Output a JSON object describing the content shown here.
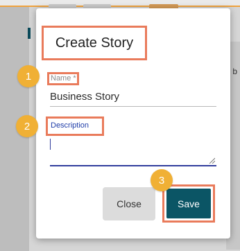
{
  "dialog": {
    "title": "Create Story",
    "name_label": "Name *",
    "name_value": "Business Story",
    "description_label": "Description",
    "description_value": "",
    "close_label": "Close",
    "save_label": "Save"
  },
  "annotations": [
    "1",
    "2",
    "3"
  ],
  "colors": {
    "highlight": "#e97b5b",
    "badge": "#f0b035",
    "save_button": "#0b5565",
    "focus_underline": "#2f3c9c",
    "label_focus": "#1e3ca8"
  },
  "background": {
    "right_edge_letter": "b"
  }
}
